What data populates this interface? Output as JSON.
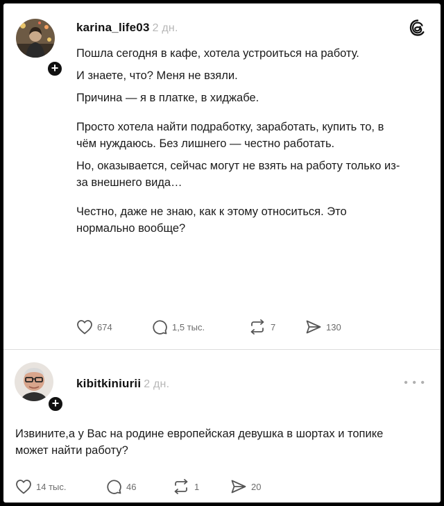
{
  "post": {
    "username": "karina_life03",
    "time": "2 дн.",
    "paragraphs": [
      "Пошла сегодня в кафе, хотела устроиться на работу.",
      "И знаете, что? Меня не взяли.",
      "Причина — я в платке, в хиджабе.",
      "Просто хотела найти подработку, заработать, купить то, в чём нуждаюсь. Без лишнего — честно работать.",
      "Но, оказывается, сейчас могут не взять на работу только из-за внешнего вида…",
      "Честно, даже не знаю, как к этому относиться. Это нормально вообще?"
    ],
    "likes": "674",
    "comments": "1,5 тыс.",
    "reposts": "7",
    "shares": "130"
  },
  "reply": {
    "username": "kibitkiniurii",
    "time": "2 дн.",
    "text": "Извините,а у Вас на родине европейская девушка в шортах и топике может найти работу?",
    "likes": "14 тыс.",
    "comments": "46",
    "reposts": "1",
    "shares": "20"
  },
  "icons": {
    "threads": "threads-logo-icon",
    "more": "more-horizontal-icon",
    "like": "heart-icon",
    "comment": "comment-icon",
    "repost": "repost-icon",
    "share": "send-icon",
    "follow": "plus-icon"
  }
}
